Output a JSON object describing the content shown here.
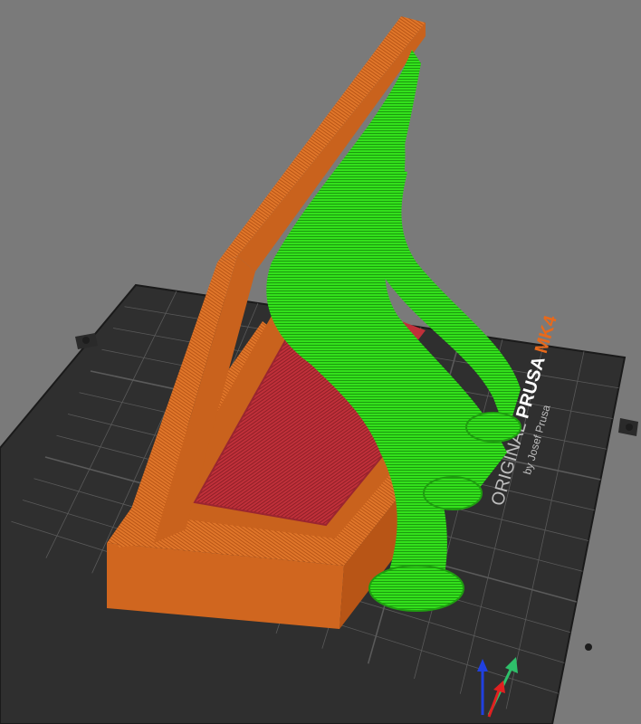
{
  "viewport": {
    "background": "#7a7a7a"
  },
  "bed": {
    "brand_line1_a": "ORIGINAL ",
    "brand_line1_b": "PRUSA",
    "brand_line1_c": " MK4",
    "brand_line2": "by Josef Prusa",
    "colors": {
      "plate": "#2f2f2f",
      "grid": "#5a5a5a",
      "brand_accent": "#e8691b"
    }
  },
  "model": {
    "colors": {
      "perimeter": "#e0762a",
      "perimeter_dark": "#c9621d",
      "infill": "#c0303a",
      "support": "#33e01c",
      "support_dark": "#1f9d10"
    }
  },
  "axes": {
    "icons": [
      "z-axis-arrow-icon",
      "y-axis-arrow-icon",
      "x-axis-arrow-icon"
    ],
    "colors": {
      "x": "#e02020",
      "y": "#2ec06a",
      "z": "#2040e0"
    }
  }
}
